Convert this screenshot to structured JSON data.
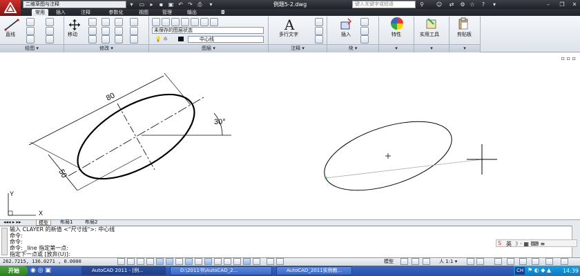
{
  "title_bar": {
    "workspace": "二维草图与注释",
    "document_title": "例题5-2.dwg",
    "search_placeholder": "键入关键字或短语"
  },
  "ribbon_tabs": [
    "常用",
    "插入",
    "注释",
    "参数化",
    "视图",
    "管理",
    "输出"
  ],
  "active_tab": "常用",
  "panels": {
    "draw": {
      "title": "绘图",
      "line_label": "直线"
    },
    "modify": {
      "title": "修改",
      "move_label": "移动"
    },
    "layers": {
      "title": "图层",
      "layer_state": "未保存的图层状态",
      "current_layer": "中心线"
    },
    "annotation": {
      "title": "注释",
      "mtext_label": "多行文字"
    },
    "block": {
      "title": "块",
      "insert_label": "插入"
    },
    "properties": {
      "label": "特性"
    },
    "utilities": {
      "label": "实用工具"
    },
    "clipboard": {
      "label": "剪贴板"
    }
  },
  "drawing": {
    "dim_length": "80",
    "dim_width": "50",
    "dim_angle": "30°",
    "ucs_x": "X",
    "ucs_y": "Y"
  },
  "layout_tabs": [
    "模型",
    "布局1",
    "布局2"
  ],
  "command_history": [
    "输入 CLAYER 的新值 <\"尺寸线\">: 中心线",
    "命令:",
    "命令:",
    "命令: _line 指定第一点:",
    "指定下一点或 [放弃(U)]:"
  ],
  "status_bar": {
    "coordinates": "262.7215, 136.0271 , 0.0000",
    "model_label": "模型",
    "annotation_scale": "1:1"
  },
  "taskbar": {
    "start": "开始",
    "tasks": [
      "AutoCAD 2011 - [例...",
      "D:\\2011书\\AutoCAD_2...",
      "AutoCAD_2011实例教..."
    ],
    "ime": "CH",
    "clock": "14:39"
  },
  "colors": {
    "title_bg": "#2a2e34",
    "ribbon_bg": "#e6eaf0",
    "taskbar": "#2f5bb8",
    "app_button": "#b3231d"
  }
}
